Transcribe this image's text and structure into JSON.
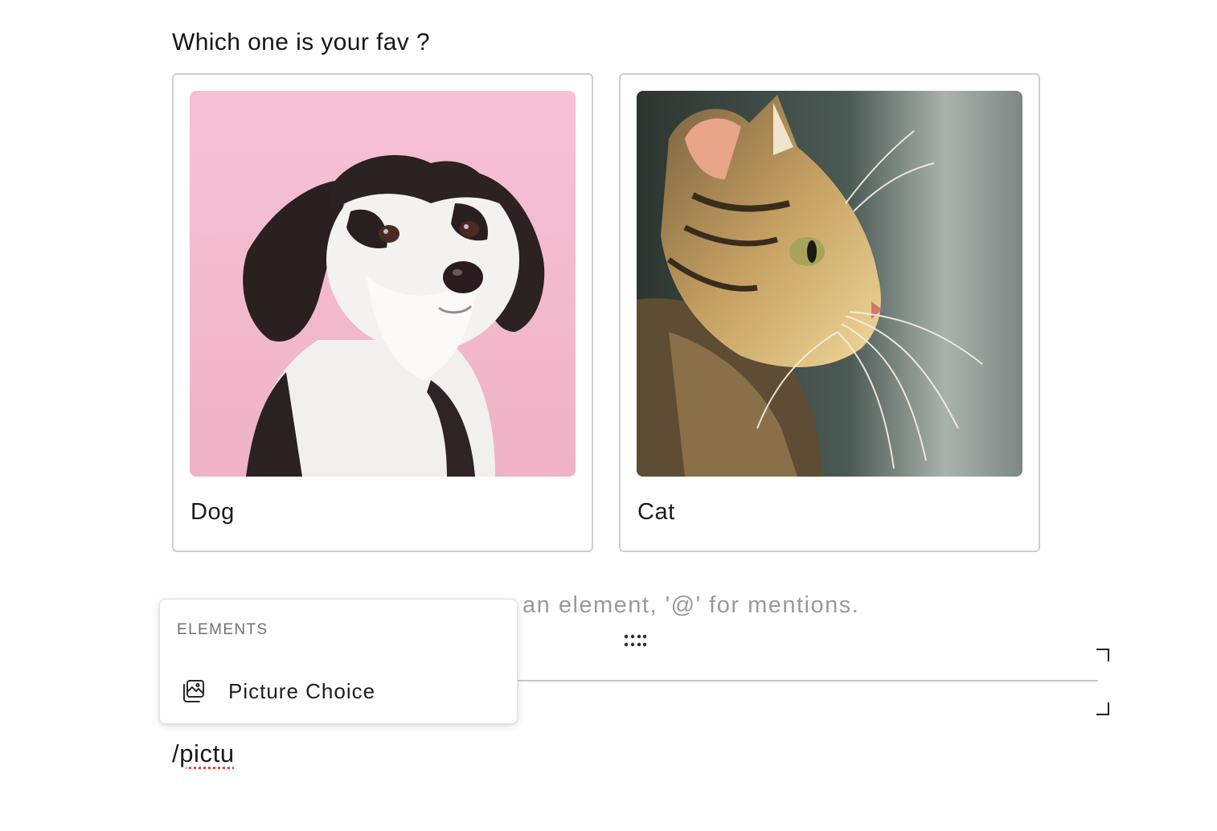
{
  "question": {
    "text": "Which one is your fav ?"
  },
  "choices": [
    {
      "label": "Dog",
      "image_icon": "dog-photo"
    },
    {
      "label": "Cat",
      "image_icon": "cat-photo"
    }
  ],
  "editor": {
    "placeholder_partial": "an element, '@' for mentions.",
    "typed_prefix": "/",
    "typed_word": "pictu"
  },
  "slash_menu": {
    "heading": "ELEMENTS",
    "items": [
      {
        "label": "Picture Choice",
        "icon": "picture-choice-icon"
      }
    ]
  },
  "colors": {
    "card_border": "#cfcfcf",
    "placeholder_text": "#9a9a9a",
    "menu_heading": "#6f6f78",
    "dog_background": "#f6bdd2"
  }
}
